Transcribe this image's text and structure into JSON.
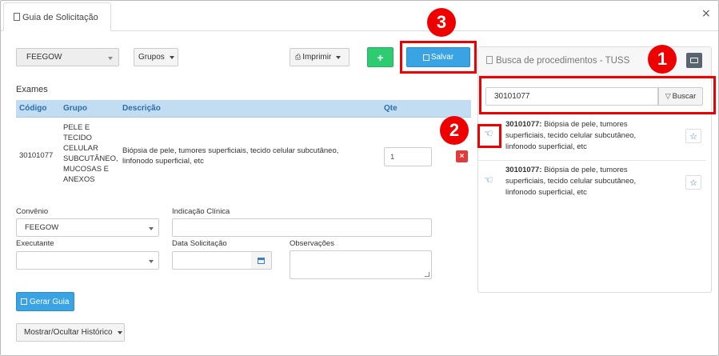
{
  "tab": {
    "label": "Guia de Solicitação"
  },
  "window": {
    "close_icon": "×"
  },
  "toolbar": {
    "convenio_select": "FEEGOW",
    "grupos_label": "Grupos",
    "imprimir_label": "Imprimir",
    "add_label": "+",
    "save_label": "Salvar"
  },
  "exames": {
    "title": "Exames",
    "columns": [
      "Código",
      "Grupo",
      "Descrição",
      "Qte"
    ],
    "rows": [
      {
        "codigo": "30101077",
        "grupo_lines": [
          "PELE E",
          "TECIDO",
          "CELULAR",
          "SUBCUTÂNEO,",
          "MUCOSAS E",
          "ANEXOS"
        ],
        "descricao_lines": [
          "Biópsia de pele, tumores superficiais, tecido celular subcutâneo,",
          "linfonodo superficial, etc"
        ],
        "qte": "1",
        "delete_label": "×"
      }
    ]
  },
  "form": {
    "convenio_label": "Convênio",
    "convenio_value": "FEEGOW",
    "indicacao_label": "Indicação Clínica",
    "indicacao_value": "",
    "executante_label": "Executante",
    "executante_value": "",
    "data_label": "Data Solicitação",
    "data_value": "",
    "obs_label": "Observações",
    "obs_value": ""
  },
  "actions": {
    "gerar_label": "Gerar Guia",
    "historico_label": "Mostrar/Ocultar Histórico"
  },
  "busca": {
    "title": "Busca de procedimentos - TUSS",
    "search_value": "30101077",
    "search_button": "Buscar",
    "results": [
      {
        "code": "30101077:",
        "lines": [
          " Biópsia de pele, tumores",
          "superficiais, tecido celular subcutâneo,",
          "linfonodo superficial, etc"
        ]
      },
      {
        "code": "30101077:",
        "lines": [
          " Biópsia de pele, tumores",
          "superficiais, tecido celular subcutâneo,",
          "linfonodo superficial, etc"
        ]
      }
    ]
  },
  "callouts": [
    "1",
    "2",
    "3"
  ],
  "colors": {
    "primary": "#3aa3e3",
    "success": "#2ecc71",
    "danger": "#e23b3b",
    "annotation_red": "#ee0000",
    "table_header": "#c2dcf2"
  },
  "icons": {
    "hand": "☜",
    "star": "☆",
    "print": "⎙",
    "filter": "▽"
  }
}
